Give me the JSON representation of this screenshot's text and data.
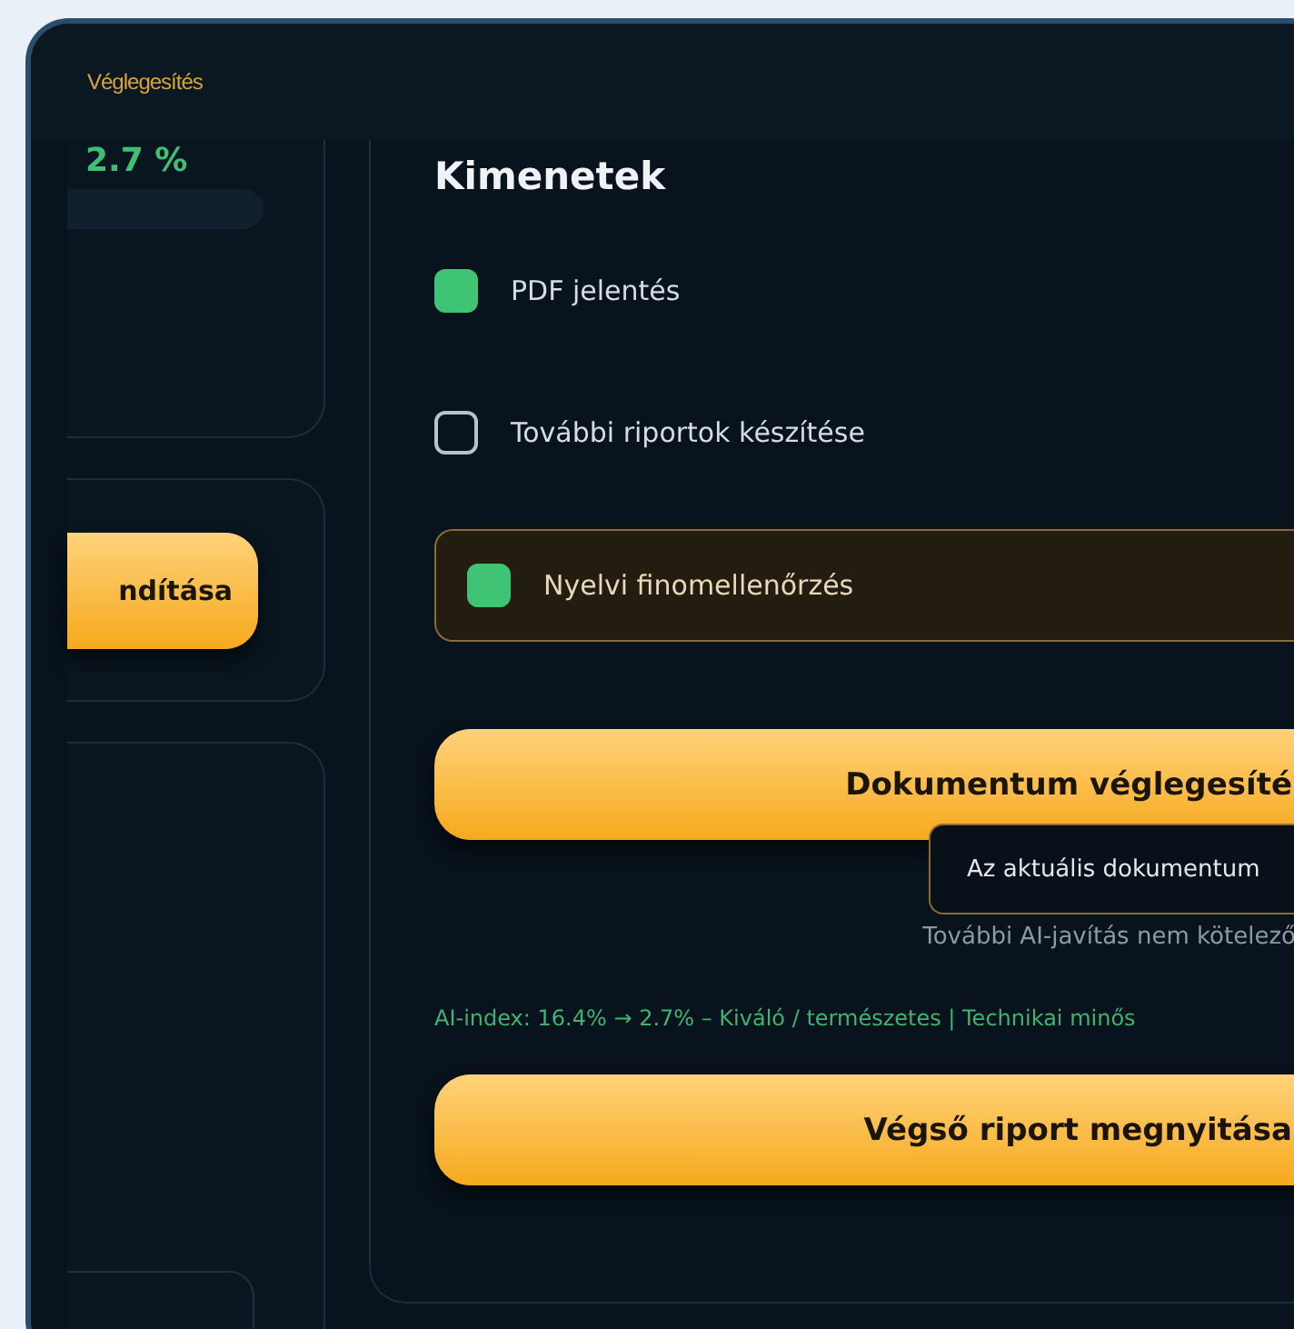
{
  "window": {
    "title": "Véglegesítés"
  },
  "sidebar": {
    "score": "2.7 %",
    "start_button": "ndítása"
  },
  "outputs": {
    "heading": "Kimenetek",
    "items": [
      {
        "label": "PDF jelentés",
        "checked": true,
        "highlighted": false
      },
      {
        "label": "További riportok készítése",
        "checked": false,
        "highlighted": false
      },
      {
        "label": "Nyelvi finomellenőrzés",
        "checked": true,
        "highlighted": true
      }
    ],
    "finalize_button": "Dokumentum véglegesíté",
    "tooltip": "Az aktuális dokumentum",
    "hint": "További AI-javítás nem kötelező",
    "status": "AI-index: 16.4% → 2.7% – Kiváló / természetes | Technikai minős",
    "open_button": "Végső riport megnyitása"
  }
}
